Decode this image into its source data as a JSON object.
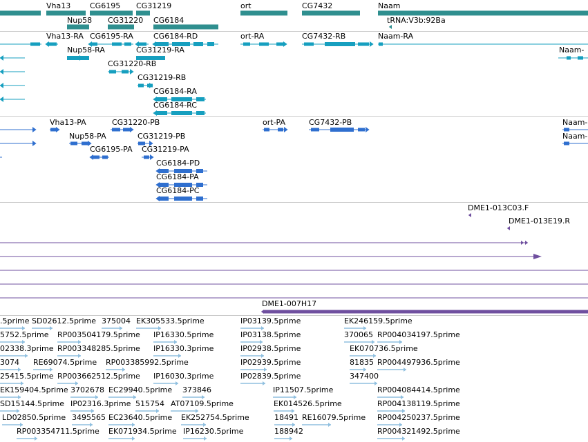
{
  "colors": {
    "gene": "#2f8f8f",
    "transcript": "#169fbf",
    "protein": "#2f6fcf",
    "clone": "#6f4f9f",
    "est": "#8fbfdf",
    "separator": "#c8c8c8"
  },
  "genes": [
    "Vha13",
    "CG6195",
    "CG31219",
    "Nup58",
    "CG31220",
    "CG6184",
    "ort",
    "CG7432",
    "Naam",
    "tRNA:V3b:92Ba"
  ],
  "transcripts": [
    "Vha13-RA",
    "CG6195-RA",
    "CG6184-RD",
    "ort-RA",
    "CG7432-RB",
    "Naam-RA",
    "Nup58-RA",
    "CG31219-RA",
    "Naam-",
    "CG31220-RB",
    "CG31219-RB",
    "CG6184-RA",
    "CG6184-RC"
  ],
  "proteins": [
    "Vha13-PA",
    "CG31220-PB",
    "ort-PA",
    "CG7432-PB",
    "Naam-",
    "Nup58-PA",
    "CG31219-PB",
    "Naam-",
    "CG6195-PA",
    "CG31219-PA",
    "CG6184-PD",
    "CG6184-PA",
    "CG6184-PC"
  ],
  "clones": [
    "DME1-013C03.F",
    "DME1-013E19.R",
    "DME1-007H17"
  ],
  "ests": [
    ".5prime",
    "SD02612.5prime",
    "375004",
    "EK305533.5prime",
    "IP03139.5prime",
    "EK246159.5prime",
    "5752.5prime",
    "RP003504179.5prime",
    "IP16330.5prime",
    "IP03138.5prime",
    "370065",
    "RP004034197.5prime",
    "02338.3prime",
    "RP003348285.5prime",
    "IP16330.3prime",
    "IP02938.5prime",
    "EK070736.5prime",
    "3074",
    "RE69074.5prime",
    "RP003385992.5prime",
    "IP02939.5prime",
    "81835",
    "RP004497936.5prime",
    "25415.5prime",
    "RP003662512.5prime",
    "IP16030.3prime",
    "IP02839.5prime",
    "347400",
    "EK159404.5prime",
    "3702678",
    "EC29940.5prime",
    "373846",
    "IP11507.5prime",
    "RP004084414.5prime",
    "SD15144.5prime",
    "IP02316.3prime",
    "515754",
    "AT07109.5prime",
    "EK014526.5prime",
    "RP004138119.5prime",
    "LD02850.5prime",
    "3495565",
    "EC23640.5prime",
    "EK252754.5prime",
    "18491",
    "RE16079.5prime",
    "RP004250237.5prime",
    "RP003354711.5prime",
    "EK071934.5prime",
    "IP16230.5prime",
    "188942",
    "RP004321492.5prime"
  ]
}
